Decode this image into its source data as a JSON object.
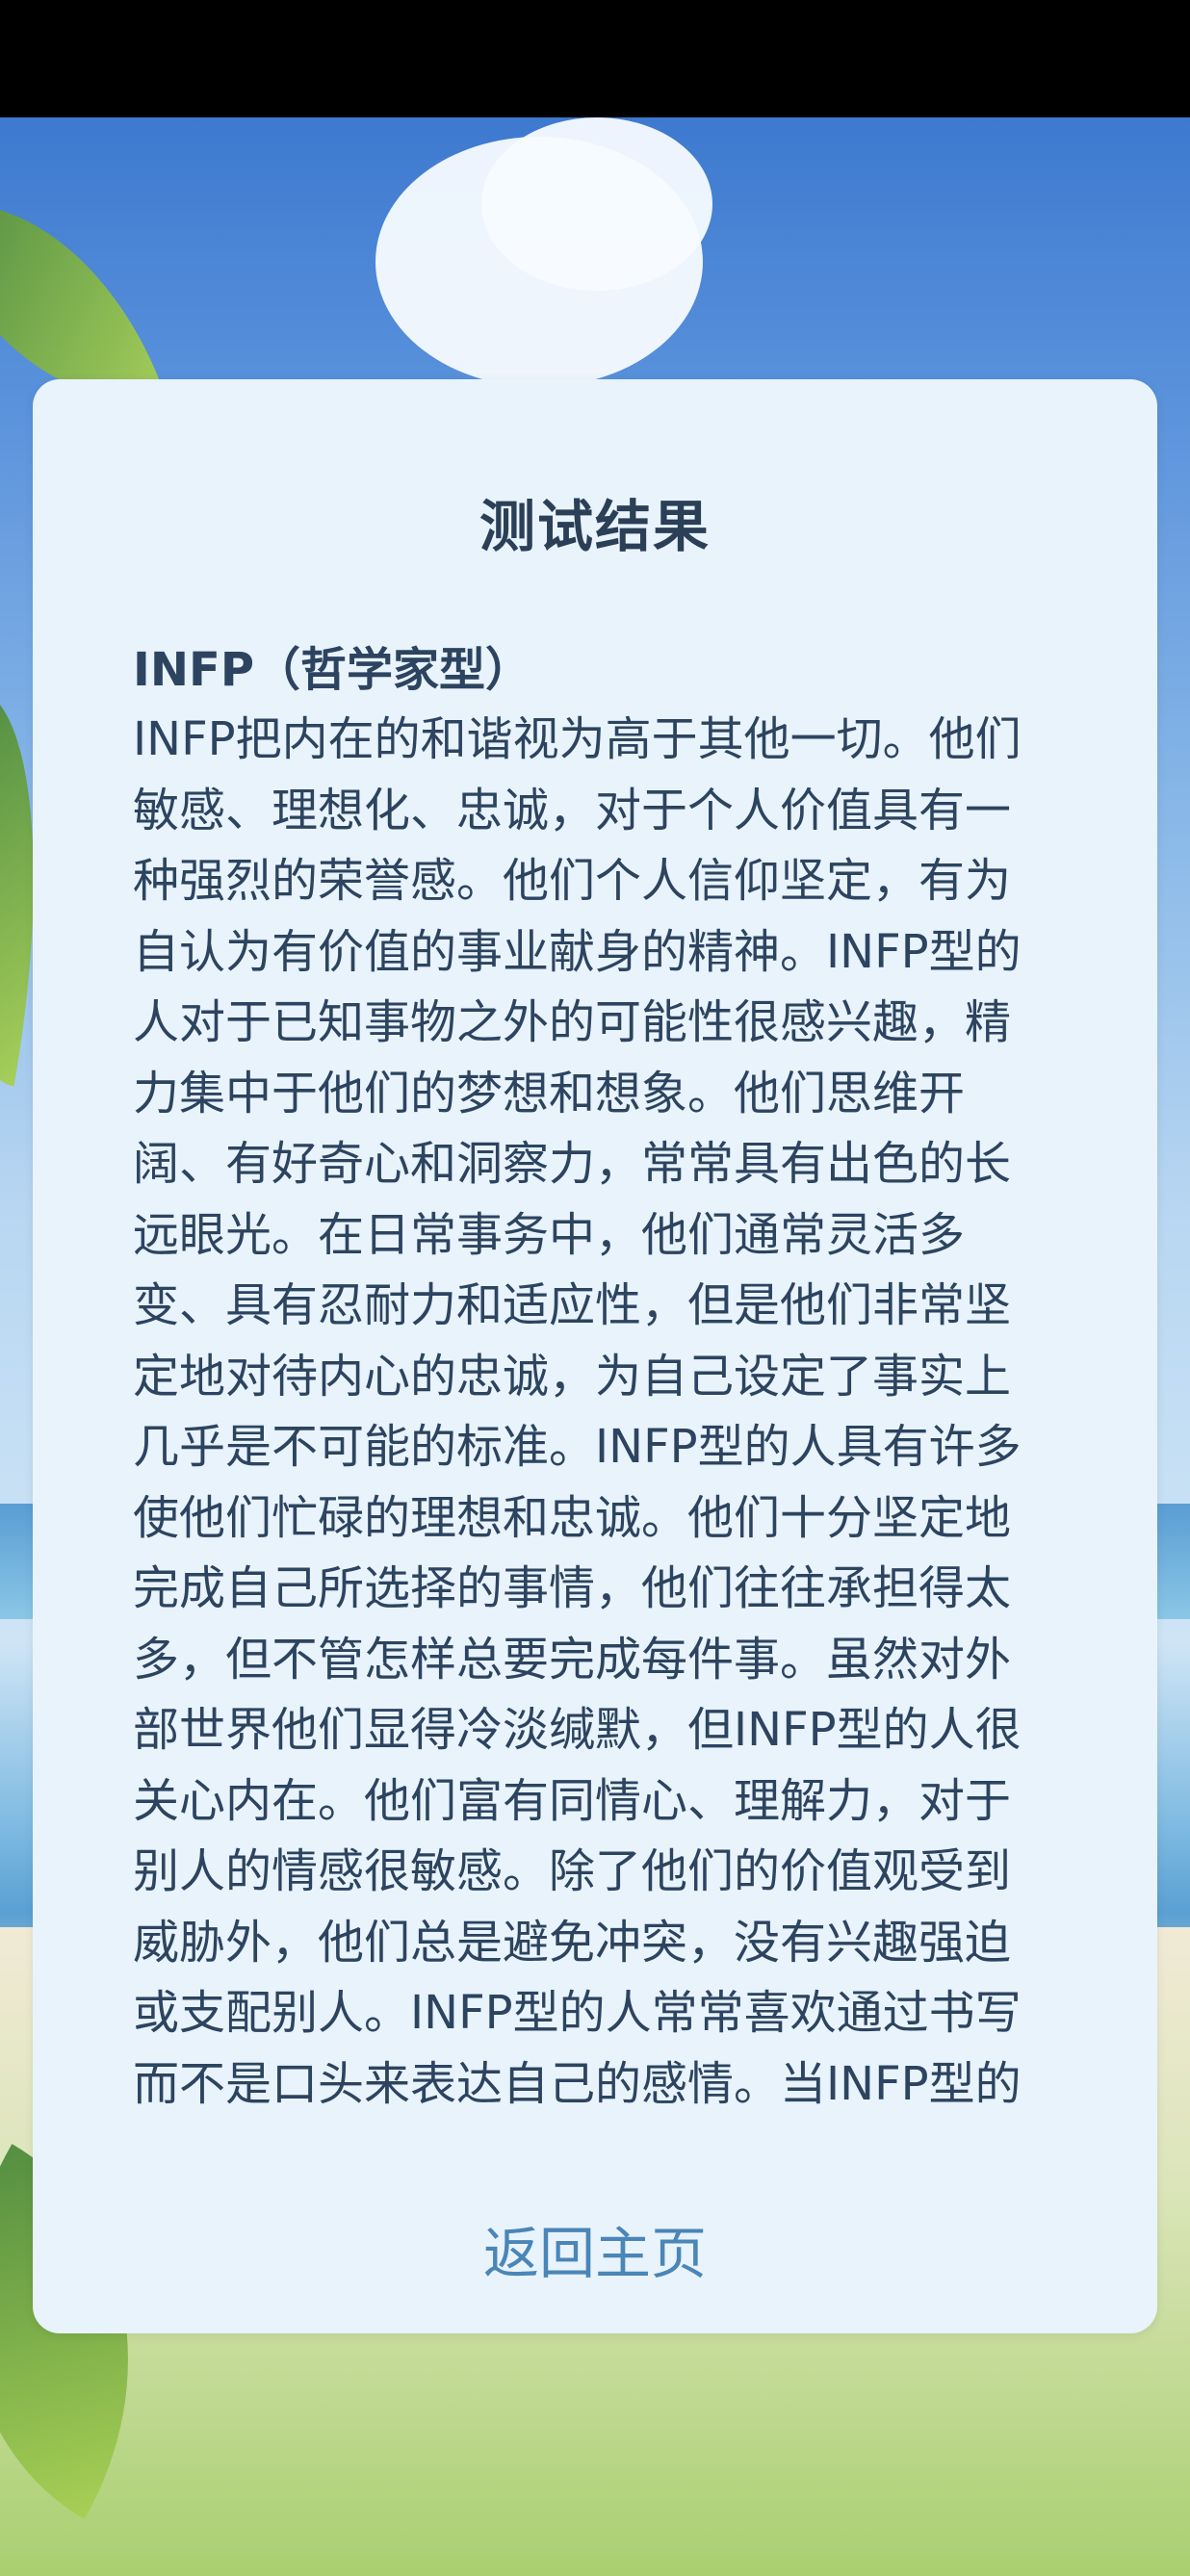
{
  "result_card": {
    "title": "测试结果",
    "type_label": "INFP（哲学家型）",
    "description": "INFP把内在的和谐视为高于其他一切。他们敏感、理想化、忠诚，对于个人价值具有一种强烈的荣誉感。他们个人信仰坚定，有为自认为有价值的事业献身的精神。INFP型的人对于已知事物之外的可能性很感兴趣，精力集中于他们的梦想和想象。他们思维开阔、有好奇心和洞察力，常常具有出色的长远眼光。在日常事务中，他们通常灵活多变、具有忍耐力和适应性，但是他们非常坚定地对待内心的忠诚，为自己设定了事实上几乎是不可能的标准。INFP型的人具有许多使他们忙碌的理想和忠诚。他们十分坚定地完成自己所选择的事情，他们往往承担得太多，但不管怎样总要完成每件事。虽然对外部世界他们显得冷淡缄默，但INFP型的人很关心内在。他们富有同情心、理解力，对于别人的情感很敏感。除了他们的价值观受到威胁外，他们总是避免冲突，没有兴趣强迫或支配别人。INFP型的人常常喜欢通过书写而不是口头来表达自己的感情。当INFP型的",
    "home_button_label": "返回主页"
  },
  "colors": {
    "card_background": "#e8f3fb",
    "title_text": "#2b3f57",
    "body_text": "#2d4460",
    "button_text": "#4a86b7"
  }
}
